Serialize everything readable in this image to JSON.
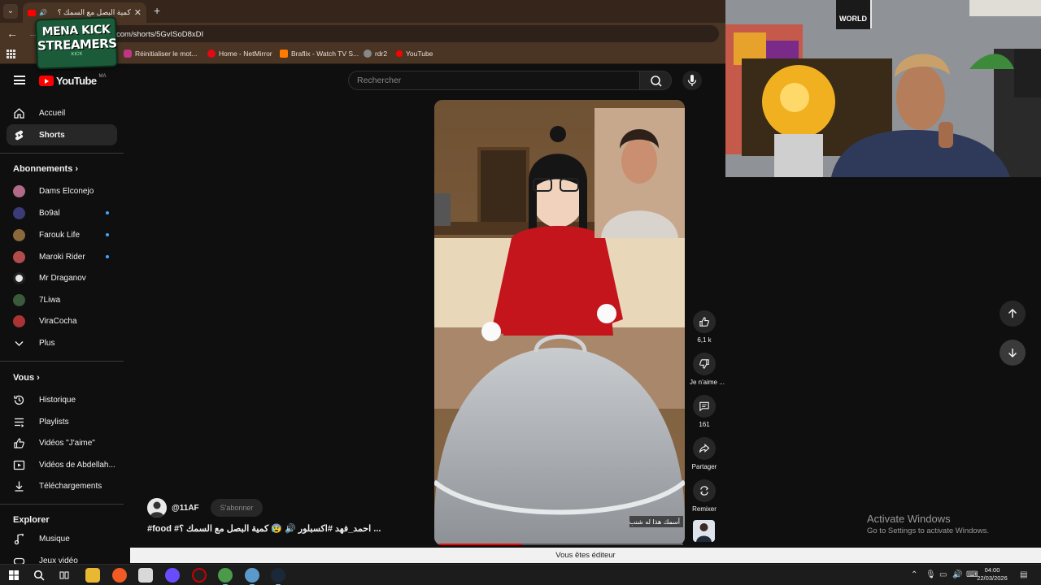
{
  "browser": {
    "tab_title": "كمية البصل مع السمك ؟",
    "url": "com/shorts/5GvISoD8xDI",
    "bookmarks": [
      {
        "label": "Réinitialiser le mot...",
        "color": "#c13584"
      },
      {
        "label": "Home - NetMirror",
        "color": "#e50914"
      },
      {
        "label": "Braflix - Watch TV S...",
        "color": "#ff7b00"
      },
      {
        "label": "rdr2",
        "color": "#888888"
      },
      {
        "label": "YouTube",
        "color": "#ff0000"
      }
    ]
  },
  "overlay_logo": {
    "line1": "MENA KICK",
    "line2": "STREAMERS",
    "line3": "KICK"
  },
  "masthead": {
    "logo_text": "YouTube",
    "country": "MA",
    "search_placeholder": "Rechercher"
  },
  "sidebar": {
    "main": [
      {
        "label": "Accueil",
        "icon": "home-icon"
      },
      {
        "label": "Shorts",
        "icon": "shorts-icon",
        "active": true
      }
    ],
    "subscriptions_title": "Abonnements",
    "subscriptions": [
      {
        "label": "Dams Elconejo",
        "color": "#b06a8a",
        "new": false
      },
      {
        "label": "Bo9al",
        "color": "#3b3b78",
        "new": true
      },
      {
        "label": "Farouk Life",
        "color": "#8a6a3a",
        "new": true
      },
      {
        "label": "Maroki Rider",
        "color": "#b24b4b",
        "new": true
      },
      {
        "label": "Mr Draganov",
        "color": "#e8e8e8",
        "new": false
      },
      {
        "label": "7Liwa",
        "color": "#3a5a3a",
        "new": false
      },
      {
        "label": "ViraCocha",
        "color": "#a33",
        "new": false
      }
    ],
    "more_label": "Plus",
    "you_title": "Vous",
    "you": [
      {
        "label": "Historique",
        "icon": "history-icon"
      },
      {
        "label": "Playlists",
        "icon": "playlists-icon"
      },
      {
        "label": "Vidéos \"J'aime\"",
        "icon": "like-icon"
      },
      {
        "label": "Vidéos de Abdellah...",
        "icon": "your-videos-icon"
      },
      {
        "label": "Téléchargements",
        "icon": "download-icon"
      }
    ],
    "explore_title": "Explorer",
    "explore": [
      {
        "label": "Musique",
        "icon": "music-icon"
      },
      {
        "label": "Jeux vidéo",
        "icon": "gaming-icon"
      }
    ]
  },
  "short": {
    "channel": "@11AF",
    "subscribe_label": "S'abonner",
    "title": "#food #احمد_فهد #اكسبلور 🔊 😰 كمية البصل مع السمك ؟ ...",
    "caption": "أسمك هذا له شنب",
    "progress": 0.34,
    "actions": {
      "like_count": "6,1 k",
      "dislike_label": "Je n'aime ...",
      "comment_count": "161",
      "share_label": "Partager",
      "remix_label": "Remixer"
    }
  },
  "editor_notice": "Vous êtes éditeur",
  "watermark": {
    "line1": "Activate Windows",
    "line2": "Go to Settings to activate Windows."
  },
  "clock": {
    "time": "04:00",
    "date": "22/03/2026"
  }
}
